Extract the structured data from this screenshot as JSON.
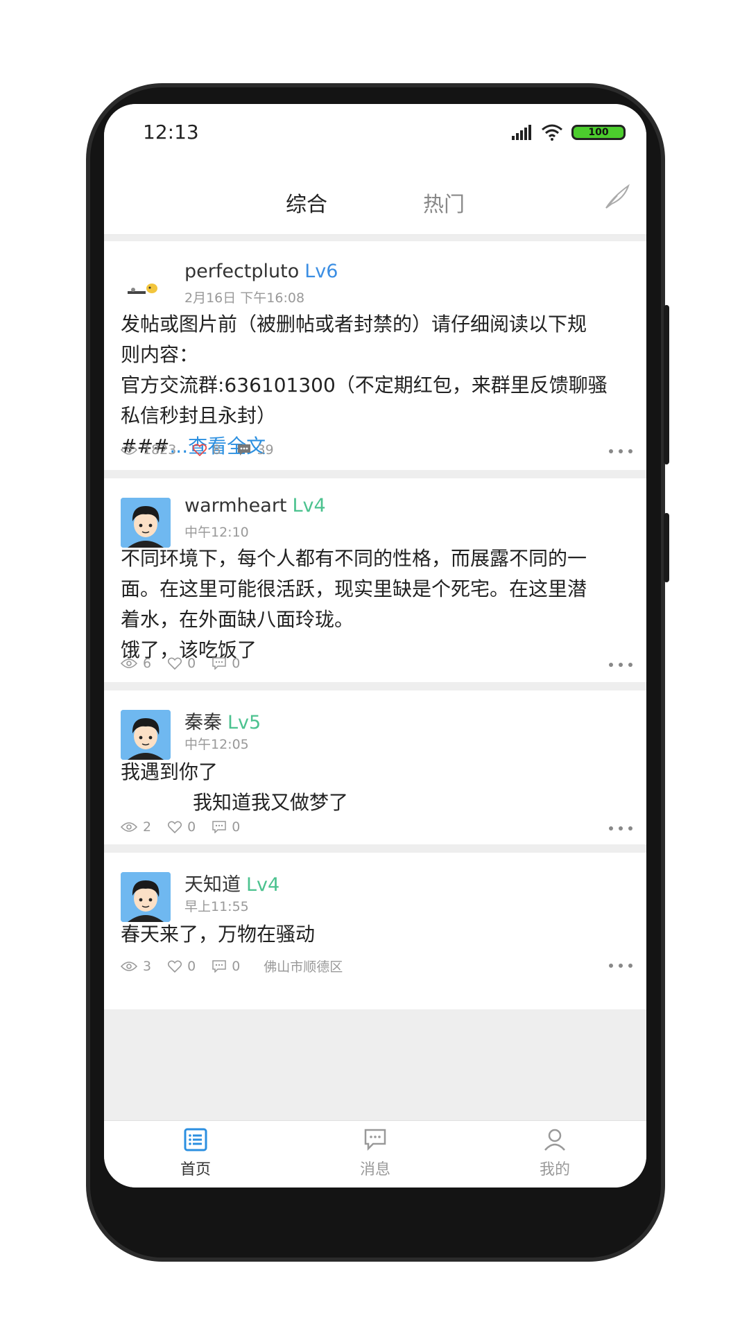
{
  "status_bar": {
    "time": "12:13",
    "battery": "100"
  },
  "tabs": {
    "active": "综合",
    "inactive": "热门"
  },
  "posts": [
    {
      "author": "perfectpluto",
      "level": "Lv6",
      "level_color": "#3b8ee3",
      "time": "2月16日 下午16:08",
      "lines": [
        "发帖或图片前（被删帖或者封禁的）请仔细阅读以下规",
        "则内容：",
        "官方交流群:636101300（不定期红包，来群里反馈聊骚",
        "私信秒封且永封）"
      ],
      "last_line_prefix": "###",
      "more_link": "...查看全文",
      "views": "1823",
      "likes": "8",
      "comments": "39"
    },
    {
      "author": "warmheart",
      "level": "Lv4",
      "level_color": "#4cc28f",
      "time": "中午12:10",
      "lines": [
        "不同环境下，每个人都有不同的性格，而展露不同的一",
        "面。在这里可能很活跃，现实里缺是个死宅。在这里潜",
        "着水，在外面缺八面玲珑。",
        "饿了，该吃饭了"
      ],
      "views": "6",
      "likes": "0",
      "comments": "0"
    },
    {
      "author": "秦秦",
      "level": "Lv5",
      "level_color": "#4cc28f",
      "time": "中午12:05",
      "lines": [
        "我遇到你了",
        "我知道我又做梦了"
      ],
      "views": "2",
      "likes": "0",
      "comments": "0"
    },
    {
      "author": "天知道",
      "level": "Lv4",
      "level_color": "#4cc28f",
      "time": "早上11:55",
      "lines": [
        "春天来了，万物在骚动"
      ],
      "views": "3",
      "likes": "0",
      "comments": "0",
      "location": "佛山市顺德区"
    }
  ],
  "bottom_nav": [
    {
      "label": "首页",
      "icon": "list-icon"
    },
    {
      "label": "消息",
      "icon": "chat-icon"
    },
    {
      "label": "我的",
      "icon": "person-icon"
    }
  ],
  "colors": {
    "accent": "#2b8fe0",
    "like_red": "#e84c4c",
    "level_green": "#4cc28f",
    "level_blue": "#3b8ee3"
  }
}
